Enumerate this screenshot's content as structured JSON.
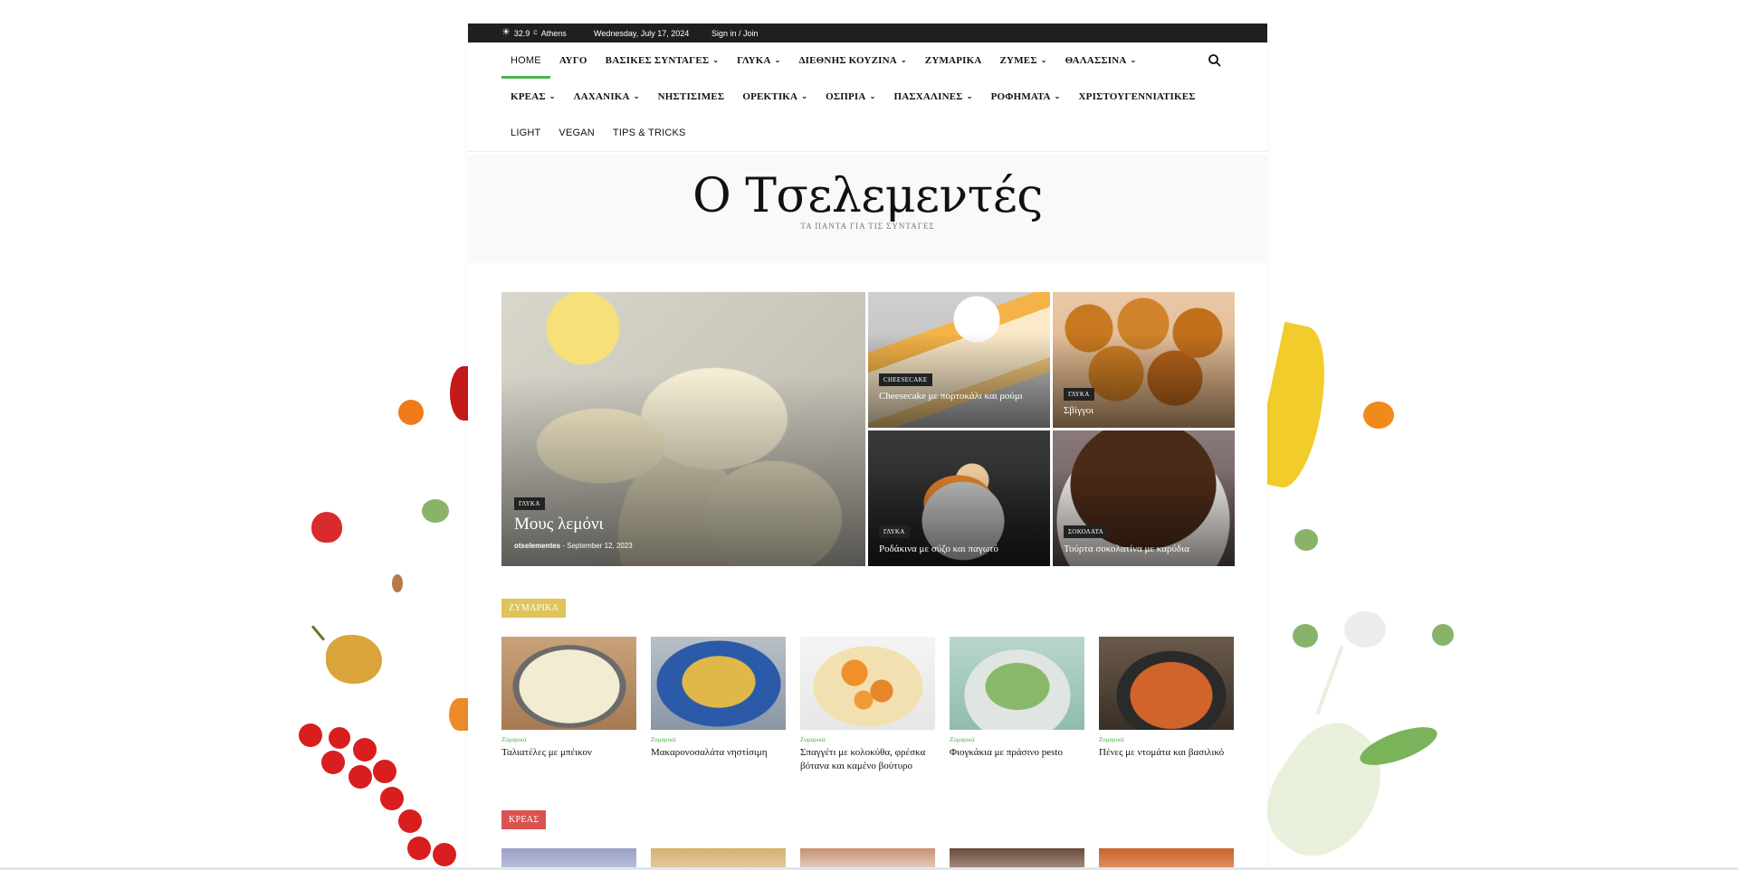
{
  "topbar": {
    "temperature": "32.9",
    "degree_unit": "C",
    "city": "Athens",
    "date": "Wednesday, July 17, 2024",
    "sign_in": "Sign in / Join"
  },
  "nav": {
    "row1": [
      {
        "label": "HOME",
        "dropdown": false,
        "active": true,
        "sans": true
      },
      {
        "label": "ΑΥΓΟ",
        "dropdown": false
      },
      {
        "label": "ΒΑΣΙΚΕΣ ΣΥΝΤΑΓΕΣ",
        "dropdown": true
      },
      {
        "label": "ΓΛΥΚΑ",
        "dropdown": true
      },
      {
        "label": "ΔΙΕΘΝΗΣ ΚΟΥΖΙΝΑ",
        "dropdown": true
      },
      {
        "label": "ΖΥΜΑΡΙΚΑ",
        "dropdown": false
      },
      {
        "label": "ΖΥΜΕΣ",
        "dropdown": true
      },
      {
        "label": "ΘΑΛΑΣΣΙΝΑ",
        "dropdown": true
      }
    ],
    "row2": [
      {
        "label": "ΚΡΕΑΣ",
        "dropdown": true
      },
      {
        "label": "ΛΑΧΑΝΙΚΑ",
        "dropdown": true
      },
      {
        "label": "ΝΗΣΤΙΣΙΜΕΣ",
        "dropdown": false
      },
      {
        "label": "ΟΡΕΚΤΙΚΑ",
        "dropdown": true
      },
      {
        "label": "ΟΣΠΡΙΑ",
        "dropdown": true
      },
      {
        "label": "ΠΑΣΧΑΛΙΝΕΣ",
        "dropdown": true
      },
      {
        "label": "ΡΟΦΗΜΑΤΑ",
        "dropdown": true
      },
      {
        "label": "ΧΡΙΣΤΟΥΓΕΝΝΙΑΤΙΚΕΣ",
        "dropdown": false
      }
    ],
    "row3": [
      {
        "label": "LIGHT",
        "dropdown": false,
        "sans": true
      },
      {
        "label": "VEGAN",
        "dropdown": false,
        "sans": true
      },
      {
        "label": "TIPS & TRICKS",
        "dropdown": false,
        "sans": true
      }
    ],
    "search_icon": "search-icon"
  },
  "masthead": {
    "logo": "Ο Τσελεμεντές",
    "tagline": "ΤΑ ΠΑΝΤΑ ΓΙΑ ΤΙΣ ΣΥΝΤΑΓΕΣ"
  },
  "hero": {
    "main": {
      "category": "ΓΛΥΚΑ",
      "title": "Μους λεμόνι",
      "author": "otselementes",
      "date": "September 12, 2023"
    },
    "items": [
      {
        "category": "CHEESECAKE",
        "title": "Cheesecake με πορτοκάλι και ρούμι"
      },
      {
        "category": "ΓΛΥΚΑ",
        "title": "Σβίγγοι"
      },
      {
        "category": "ΓΛΥΚΑ",
        "title": "Ροδάκινα με σύζο και παγωτό"
      },
      {
        "category": "ΣΟΚΟΛΑΤΑ",
        "title": "Τούρτα σοκολατίνα με καρύδια"
      }
    ]
  },
  "sections": {
    "pasta": {
      "label": "ΖΥΜΑΡΙΚΑ",
      "color": "#e0c35a",
      "cards": [
        {
          "category": "Ζυμαρικά",
          "title": "Ταλιατέλες με μπέικον"
        },
        {
          "category": "Ζυμαρικά",
          "title": "Μακαρονοσαλάτα νηστίσιμη"
        },
        {
          "category": "Ζυμαρικά",
          "title": "Σπαγγέτι με κολοκύθα, φρέσκα βότανα και καμένο βούτυρο"
        },
        {
          "category": "Ζυμαρικά",
          "title": "Φιογκάκια με πράσινο pesto"
        },
        {
          "category": "Ζυμαρικά",
          "title": "Πένες με ντομάτα και βασιλικό"
        }
      ]
    },
    "meat": {
      "label": "ΚΡΕΑΣ",
      "color": "#d9534f"
    }
  }
}
